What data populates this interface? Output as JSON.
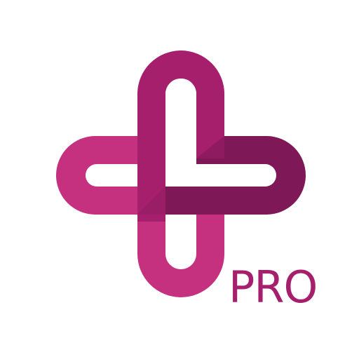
{
  "logo": {
    "badge_text": "PRO",
    "colors": {
      "magenta_light": "#C5307F",
      "magenta_mid": "#B02A72",
      "magenta_dark": "#9A1E66",
      "plum_dark": "#7F1856",
      "background": "#FFFFFF"
    }
  }
}
